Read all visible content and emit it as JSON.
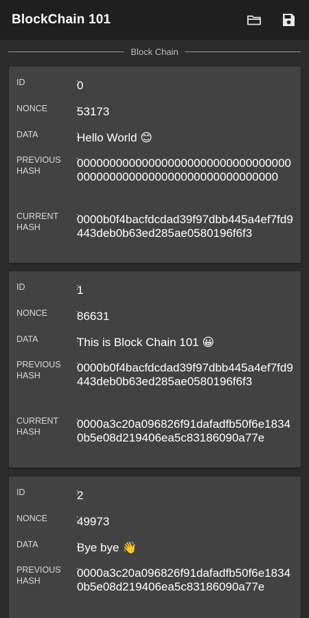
{
  "appbar": {
    "title": "BlockChain 101",
    "folder_icon": "folder-open-icon",
    "save_icon": "save-icon"
  },
  "section": {
    "label": "Block Chain"
  },
  "labels": {
    "id": "ID",
    "nonce": "NONCE",
    "data": "DATA",
    "previous_hash_1": "PREVIOUS",
    "previous_hash_2": "HASH",
    "current_hash_1": "CURRENT",
    "current_hash_2": "HASH",
    "separator": ":"
  },
  "blocks": [
    {
      "id": "0",
      "nonce": "53173",
      "data": "Hello World 😊",
      "previous_hash": "0000000000000000000000000000000000000000000000000000000000000000",
      "current_hash": "0000b0f4bacfdcdad39f97dbb445a4ef7fd9443deb0b63ed285ae0580196f6f3"
    },
    {
      "id": "1",
      "nonce": "86631",
      "data": "This is Block Chain 101 😀",
      "previous_hash": "0000b0f4bacfdcdad39f97dbb445a4ef7fd9443deb0b63ed285ae0580196f6f3",
      "current_hash": "0000a3c20a096826f91dafadfb50f6e18340b5e08d219406ea5c83186090a77e"
    },
    {
      "id": "2",
      "nonce": "49973",
      "data": "Bye bye 👋",
      "previous_hash": "0000a3c20a096826f91dafadfb50f6e18340b5e08d219406ea5c83186090a77e"
    }
  ],
  "colors": {
    "background": "#2b2b2b",
    "appbar": "#1f1f1f",
    "card": "#424242"
  }
}
